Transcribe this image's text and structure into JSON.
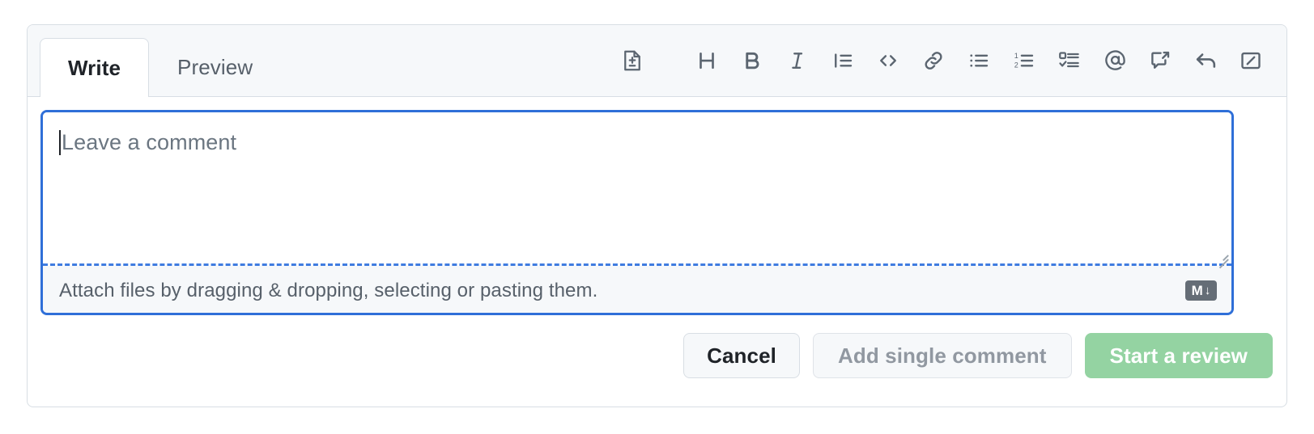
{
  "comment_form": {
    "tabs": [
      {
        "label": "Write",
        "name": "tab-write",
        "selected": true
      },
      {
        "label": "Preview",
        "name": "tab-preview",
        "selected": false
      }
    ],
    "toolbar": {
      "items": [
        {
          "icon": "suggest-change-icon",
          "title": "Add a suggestion"
        },
        {
          "icon": "heading-icon",
          "title": "Add heading text"
        },
        {
          "icon": "bold-icon",
          "title": "Add bold text"
        },
        {
          "icon": "italic-icon",
          "title": "Add italic text"
        },
        {
          "icon": "quote-icon",
          "title": "Add a quote"
        },
        {
          "icon": "code-icon",
          "title": "Add code"
        },
        {
          "icon": "link-icon",
          "title": "Add a link"
        },
        {
          "icon": "unordered-list-icon",
          "title": "Add a bulleted list"
        },
        {
          "icon": "ordered-list-icon",
          "title": "Add a numbered list"
        },
        {
          "icon": "task-list-icon",
          "title": "Add a task list"
        },
        {
          "icon": "mention-icon",
          "title": "Directly mention a user or team"
        },
        {
          "icon": "saved-reply-icon",
          "title": "Reference an issue, pull request, or discussion"
        },
        {
          "icon": "reply-icon",
          "title": "Add saved reply"
        },
        {
          "icon": "slash-command-icon",
          "title": "Slash commands"
        }
      ]
    },
    "editor": {
      "placeholder": "Leave a comment",
      "value": "",
      "attach_hint": "Attach files by dragging & dropping, selecting or pasting them.",
      "markdown_badge": {
        "letter": "M",
        "arrow": "↓"
      }
    },
    "buttons": [
      {
        "label": "Cancel",
        "name": "cancel-button",
        "style": "default",
        "disabled": false
      },
      {
        "label": "Add single comment",
        "name": "add-single-comment-button",
        "style": "disabled",
        "disabled": true
      },
      {
        "label": "Start a review",
        "name": "start-a-review-button",
        "style": "primary-disabled",
        "disabled": true
      }
    ],
    "colors": {
      "focus_border": "#2f6fd8",
      "primary_disabled_bg": "#94d3a2",
      "header_bg": "#f6f8fa",
      "border": "#d8dee4",
      "text": "#1f2328",
      "muted_text": "#57606a"
    }
  }
}
